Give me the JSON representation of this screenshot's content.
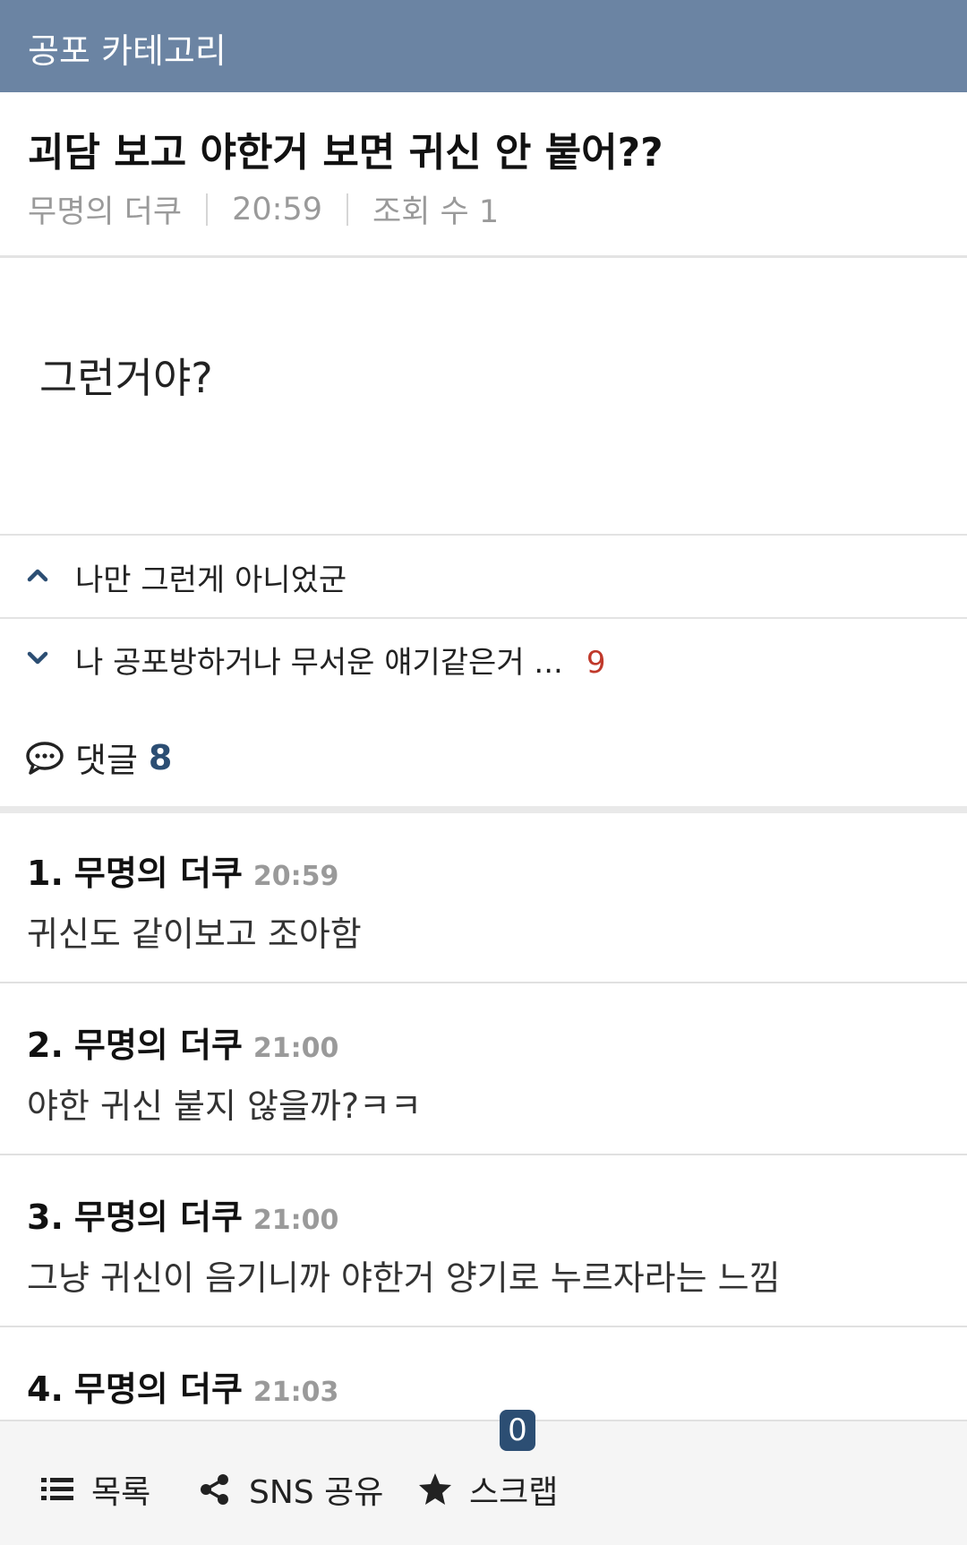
{
  "category": {
    "label": "공포 카테고리"
  },
  "post": {
    "title": "괴담 보고 야한거 보면 귀신 안 붙어??",
    "author": "무명의 더쿠",
    "time": "20:59",
    "views": "조회 수 1",
    "body": "그런거야?"
  },
  "nav": {
    "prev": {
      "icon": "chevron-up-icon",
      "title": "나만 그런게 아니었군"
    },
    "next": {
      "icon": "chevron-down-icon",
      "title": "나 공포방하거나 무서운 얘기같은거 ...",
      "count": "9"
    }
  },
  "comments_header": {
    "label": "댓글",
    "count": "8"
  },
  "comments": [
    {
      "num": "1.",
      "author": "무명의 더쿠",
      "time": "20:59",
      "text": "귀신도 같이보고 조아함"
    },
    {
      "num": "2.",
      "author": "무명의 더쿠",
      "time": "21:00",
      "text": "야한 귀신 붙지 않을까?ㅋㅋ"
    },
    {
      "num": "3.",
      "author": "무명의 더쿠",
      "time": "21:00",
      "text": "그냥 귀신이 음기니까 야한거 양기로 누르자라는 느낌"
    },
    {
      "num": "4.",
      "author": "무명의 더쿠",
      "time": "21:03",
      "text": ""
    }
  ],
  "bottom_bar": {
    "list_label": "목록",
    "share_label": "SNS 공유",
    "scrap_label": "스크랩",
    "scrap_count": "0"
  },
  "colors": {
    "category_bar": "#6b84a3",
    "accent": "#2c4e73",
    "count_red": "#c0392b"
  }
}
